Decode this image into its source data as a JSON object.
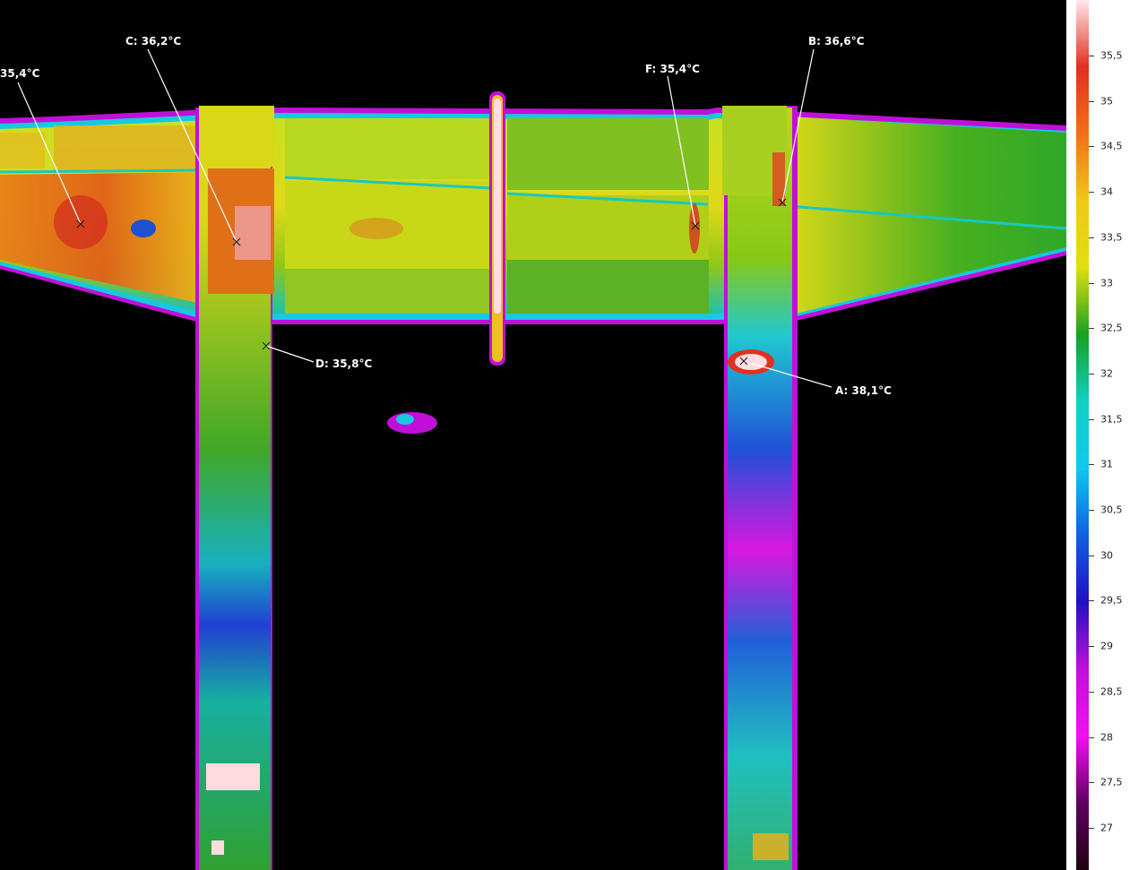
{
  "markers": [
    {
      "id": "E",
      "label": "35,4°C"
    },
    {
      "id": "C",
      "label": "C: 36,2°C"
    },
    {
      "id": "F",
      "label": "F: 35,4°C"
    },
    {
      "id": "B",
      "label": "B: 36,6°C"
    },
    {
      "id": "D",
      "label": "D: 35,8°C"
    },
    {
      "id": "A",
      "label": "A: 38,1°C"
    }
  ],
  "scale": {
    "ticks": [
      "35,5",
      "35",
      "34,5",
      "34",
      "33,5",
      "33",
      "32,5",
      "32",
      "31,5",
      "31",
      "30,5",
      "30",
      "29,5",
      "29",
      "28,5",
      "28",
      "27,5",
      "27"
    ],
    "colors": [
      "#ffe8ec",
      "#e0301e",
      "#f07018",
      "#f0c818",
      "#e0e010",
      "#18a020",
      "#10d0c0",
      "#10c8f0",
      "#1060e0",
      "#2010c0",
      "#c010d8",
      "#f010f0",
      "#600060",
      "#200010"
    ]
  }
}
